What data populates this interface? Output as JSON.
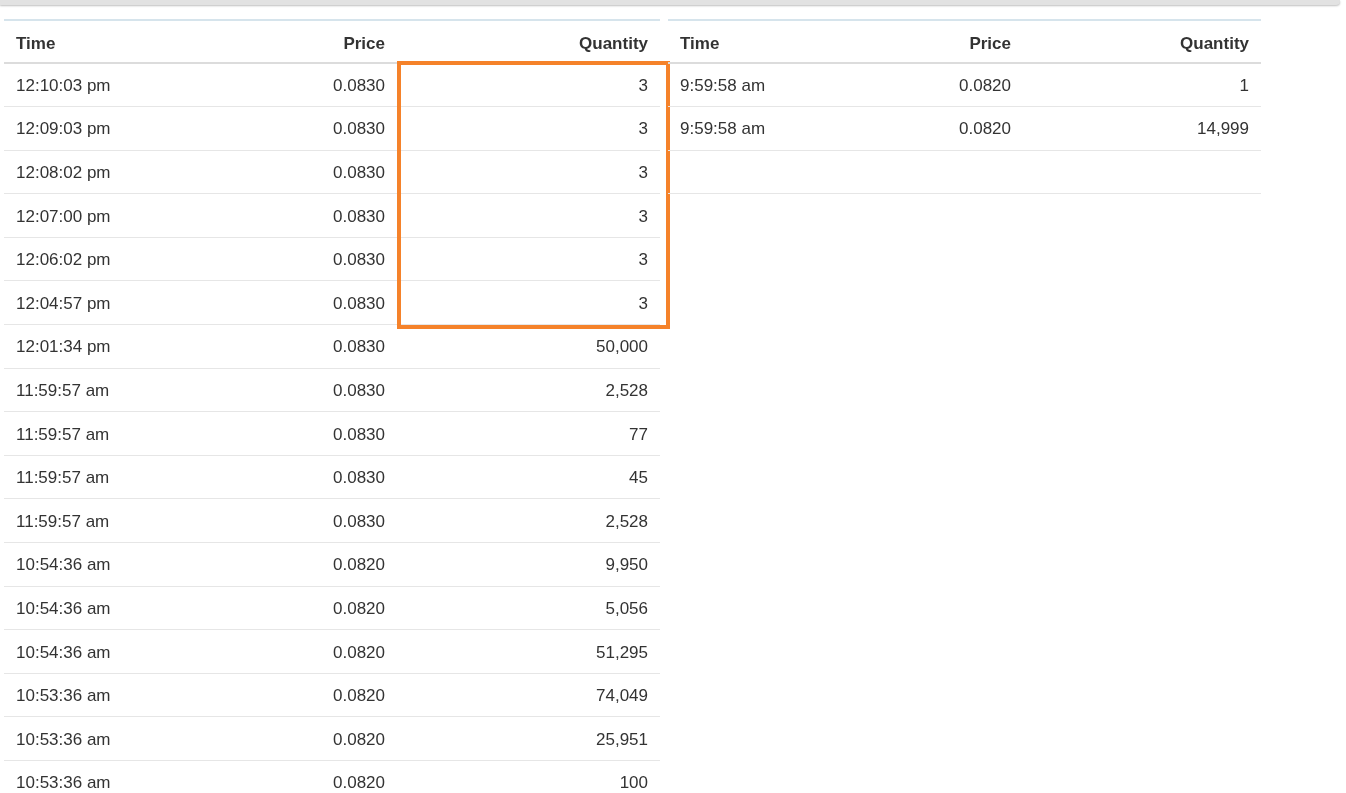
{
  "tables": [
    {
      "columns": [
        "Time",
        "Price",
        "Quantity"
      ],
      "rows": [
        {
          "cells": [
            "12:10:03 pm",
            "0.0830",
            "3"
          ],
          "highlighted": true
        },
        {
          "cells": [
            "12:09:03 pm",
            "0.0830",
            "3"
          ],
          "highlighted": true
        },
        {
          "cells": [
            "12:08:02 pm",
            "0.0830",
            "3"
          ],
          "highlighted": true
        },
        {
          "cells": [
            "12:07:00 pm",
            "0.0830",
            "3"
          ],
          "highlighted": true
        },
        {
          "cells": [
            "12:06:02 pm",
            "0.0830",
            "3"
          ],
          "highlighted": true
        },
        {
          "cells": [
            "12:04:57 pm",
            "0.0830",
            "3"
          ],
          "highlighted": true
        },
        {
          "cells": [
            "12:01:34 pm",
            "0.0830",
            "50,000"
          ],
          "highlighted": false
        },
        {
          "cells": [
            "11:59:57 am",
            "0.0830",
            "2,528"
          ],
          "highlighted": false
        },
        {
          "cells": [
            "11:59:57 am",
            "0.0830",
            "77"
          ],
          "highlighted": false
        },
        {
          "cells": [
            "11:59:57 am",
            "0.0830",
            "45"
          ],
          "highlighted": false
        },
        {
          "cells": [
            "11:59:57 am",
            "0.0830",
            "2,528"
          ],
          "highlighted": false
        },
        {
          "cells": [
            "10:54:36 am",
            "0.0820",
            "9,950"
          ],
          "highlighted": false
        },
        {
          "cells": [
            "10:54:36 am",
            "0.0820",
            "5,056"
          ],
          "highlighted": false
        },
        {
          "cells": [
            "10:54:36 am",
            "0.0820",
            "51,295"
          ],
          "highlighted": false
        },
        {
          "cells": [
            "10:53:36 am",
            "0.0820",
            "74,049"
          ],
          "highlighted": false
        },
        {
          "cells": [
            "10:53:36 am",
            "0.0820",
            "25,951"
          ],
          "highlighted": false
        },
        {
          "cells": [
            "10:53:36 am",
            "0.0820",
            "100"
          ],
          "highlighted": false
        }
      ]
    },
    {
      "columns": [
        "Time",
        "Price",
        "Quantity"
      ],
      "rows": [
        {
          "cells": [
            "9:59:58 am",
            "0.0820",
            "1"
          ],
          "highlighted": false
        },
        {
          "cells": [
            "9:59:58 am",
            "0.0820",
            "14,999"
          ],
          "highlighted": false
        }
      ]
    }
  ]
}
